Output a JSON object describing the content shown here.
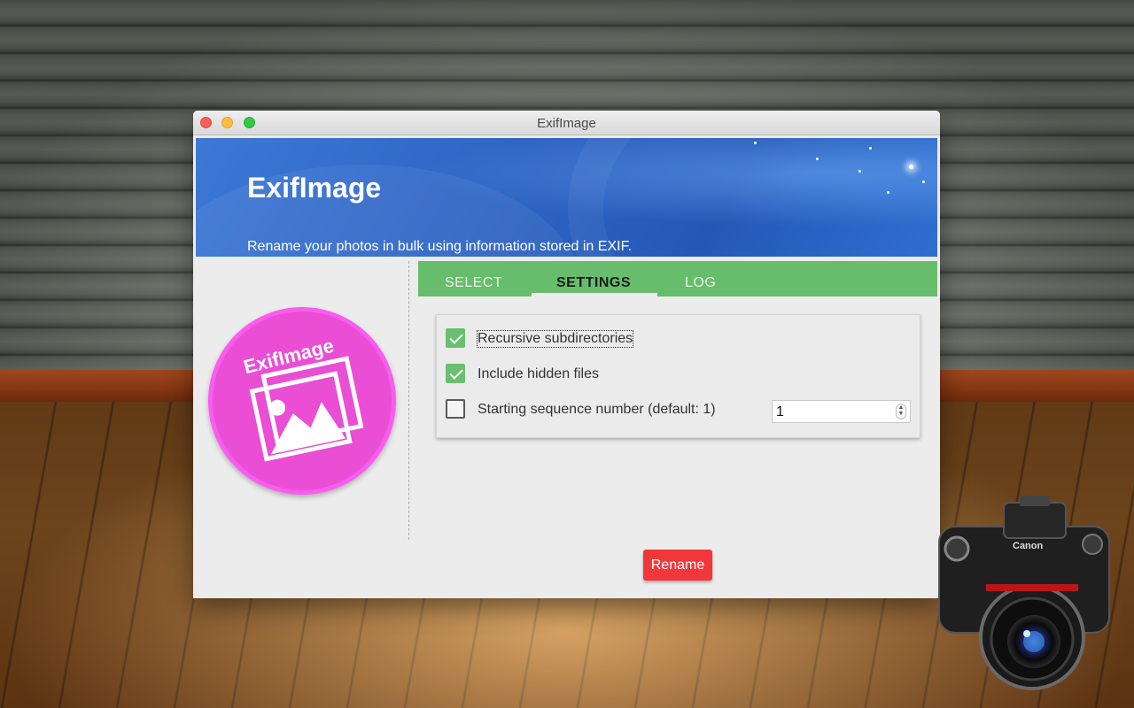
{
  "window": {
    "title": "ExifImage"
  },
  "banner": {
    "title": "ExifImage",
    "subtitle": "Rename your photos in bulk using information stored in EXIF."
  },
  "logo": {
    "text": "ExifImage",
    "icon": "photo-icon"
  },
  "tabs": [
    {
      "label": "SELECT",
      "active": false
    },
    {
      "label": "SETTINGS",
      "active": true
    },
    {
      "label": "LOG",
      "active": false
    }
  ],
  "settings": {
    "options": [
      {
        "label": "Recursive subdirectories",
        "checked": true
      },
      {
        "label": "Include hidden files",
        "checked": true
      },
      {
        "label": "Starting sequence number (default: 1)",
        "checked": false
      }
    ],
    "sequence_value": "1"
  },
  "actions": {
    "rename_label": "Rename"
  },
  "camera": {
    "brand": "Canon"
  },
  "colors": {
    "banner": "#2f65c4",
    "tabs": "#67bd6b",
    "checkbox_checked": "#6abf6e",
    "logo": "#e94ed5",
    "rename_button": "#f2373b"
  }
}
